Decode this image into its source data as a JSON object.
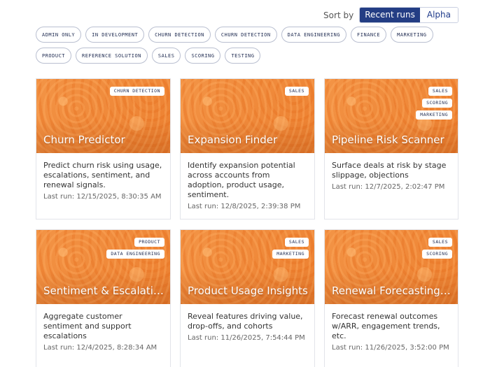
{
  "sort": {
    "label": "Sort by",
    "options": [
      "Recent runs",
      "Alpha"
    ],
    "selected": "Recent runs"
  },
  "filters": [
    "ADMIN ONLY",
    "IN DEVELOPMENT",
    "CHURN DETECTION",
    "CHURN DETECTION",
    "DATA ENGINEERING",
    "FINANCE",
    "MARKETING",
    "PRODUCT",
    "REFERENCE SOLUTION",
    "SALES",
    "SCORING",
    "TESTING"
  ],
  "cards": [
    {
      "title": "Churn Predictor",
      "tags": [
        "CHURN DETECTION"
      ],
      "description": "Predict churn risk using usage, escalations, sentiment, and renewal signals.",
      "last_run": "Last run: 12/15/2025, 8:30:35 AM"
    },
    {
      "title": "Expansion Finder",
      "tags": [
        "SALES"
      ],
      "description": "Identify expansion potential across accounts from adoption, product usage, sentiment.",
      "last_run": "Last run: 12/8/2025, 2:39:38 PM"
    },
    {
      "title": "Pipeline Risk Scanner",
      "tags": [
        "SALES",
        "SCORING",
        "MARKETING"
      ],
      "description": "Surface deals at risk by stage slippage, objections",
      "last_run": "Last run: 12/7/2025, 2:02:47 PM"
    },
    {
      "title": "Sentiment & Escalation",
      "tags": [
        "PRODUCT",
        "DATA ENGINEERING"
      ],
      "description": "Aggregate customer sentiment and support escalations",
      "last_run": "Last run: 12/4/2025, 8:28:34 AM"
    },
    {
      "title": "Product Usage Insights",
      "tags": [
        "SALES",
        "MARKETING"
      ],
      "description": "Reveal features driving value, drop-offs, and cohorts",
      "last_run": "Last run: 11/26/2025, 7:54:44 PM"
    },
    {
      "title": "Renewal Forecasting ...",
      "tags": [
        "SALES",
        "SCORING"
      ],
      "description": "Forecast renewal outcomes w/ARR, engagement trends, etc.",
      "last_run": "Last run: 11/26/2025, 3:52:00 PM"
    }
  ]
}
